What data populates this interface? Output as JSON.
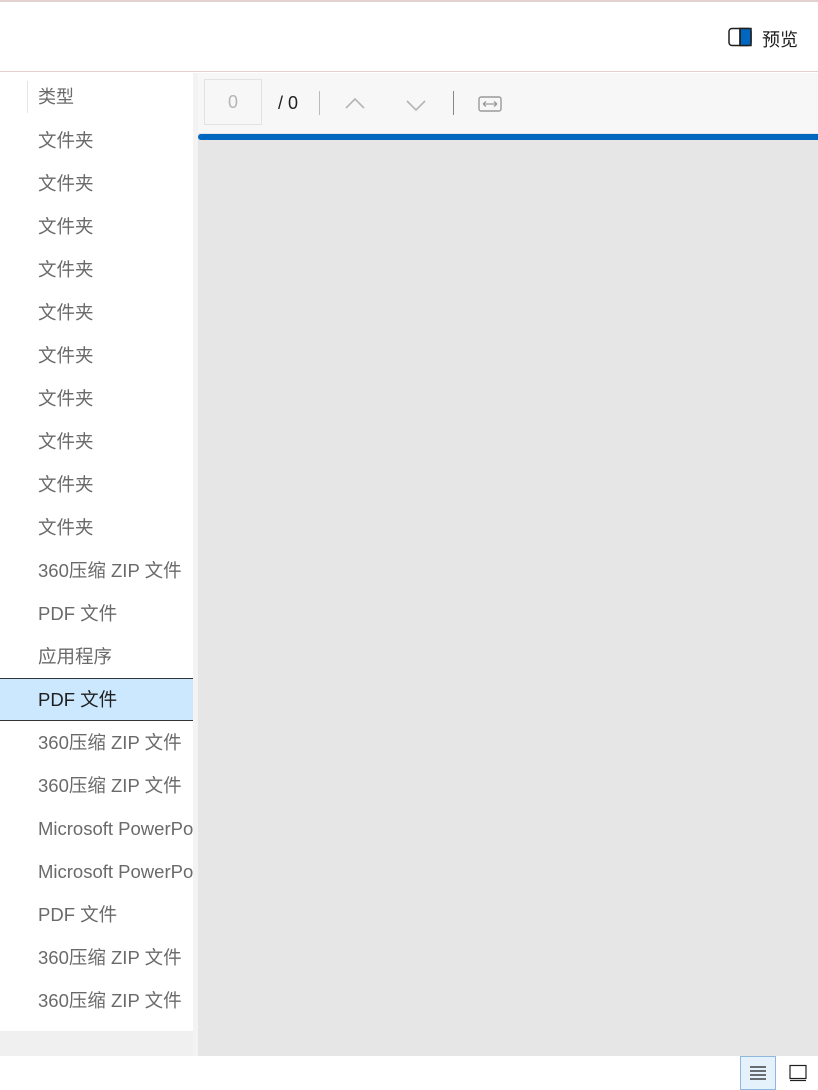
{
  "header": {
    "preview_label": "预览",
    "preview_icon": "panel-split-icon"
  },
  "list": {
    "column_header": "类型",
    "rows": [
      "文件夹",
      "文件夹",
      "文件夹",
      "文件夹",
      "文件夹",
      "文件夹",
      "文件夹",
      "文件夹",
      "文件夹",
      "文件夹",
      "360压缩 ZIP 文件",
      "PDF 文件",
      "应用程序",
      "PDF 文件",
      "360压缩 ZIP 文件",
      "360压缩 ZIP 文件",
      "Microsoft PowerPoint",
      "Microsoft PowerPoint",
      "PDF 文件",
      "360压缩 ZIP 文件",
      "360压缩 ZIP 文件"
    ],
    "selected_index": 13
  },
  "viewer": {
    "page_value": "0",
    "page_total": "/ 0",
    "accent_color": "#0067c0"
  },
  "status_bar": {
    "details_icon": "details-view-icon",
    "tiles_icon": "large-icons-view-icon"
  }
}
